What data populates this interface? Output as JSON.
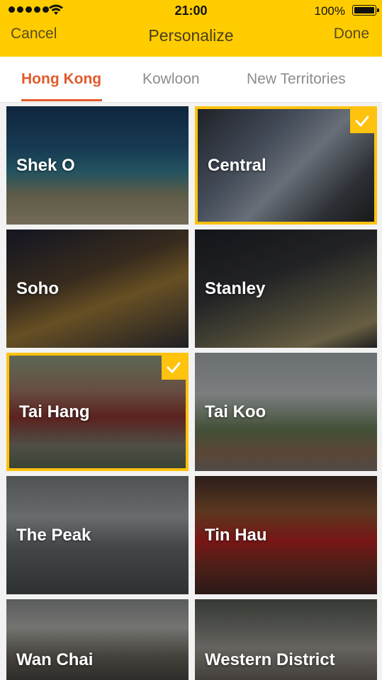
{
  "status_bar": {
    "time": "21:00",
    "battery_percent": "100%"
  },
  "nav": {
    "cancel_label": "Cancel",
    "title": "Personalize",
    "done_label": "Done"
  },
  "tabs": [
    {
      "label": "Hong Kong",
      "active": true
    },
    {
      "label": "Kowloon",
      "active": false
    },
    {
      "label": "New Territories",
      "active": false
    }
  ],
  "tiles": [
    {
      "label": "Shek O",
      "selected": false
    },
    {
      "label": "Central",
      "selected": true
    },
    {
      "label": "Soho",
      "selected": false
    },
    {
      "label": "Stanley",
      "selected": false
    },
    {
      "label": "Tai Hang",
      "selected": true
    },
    {
      "label": "Tai Koo",
      "selected": false
    },
    {
      "label": "The Peak",
      "selected": false
    },
    {
      "label": "Tin Hau",
      "selected": false
    },
    {
      "label": "Wan Chai",
      "selected": false
    },
    {
      "label": "Western District",
      "selected": false
    }
  ],
  "colors": {
    "accent_yellow": "#FFCC00",
    "tab_active": "#E25A2A",
    "selection_border": "#FFC20E"
  }
}
